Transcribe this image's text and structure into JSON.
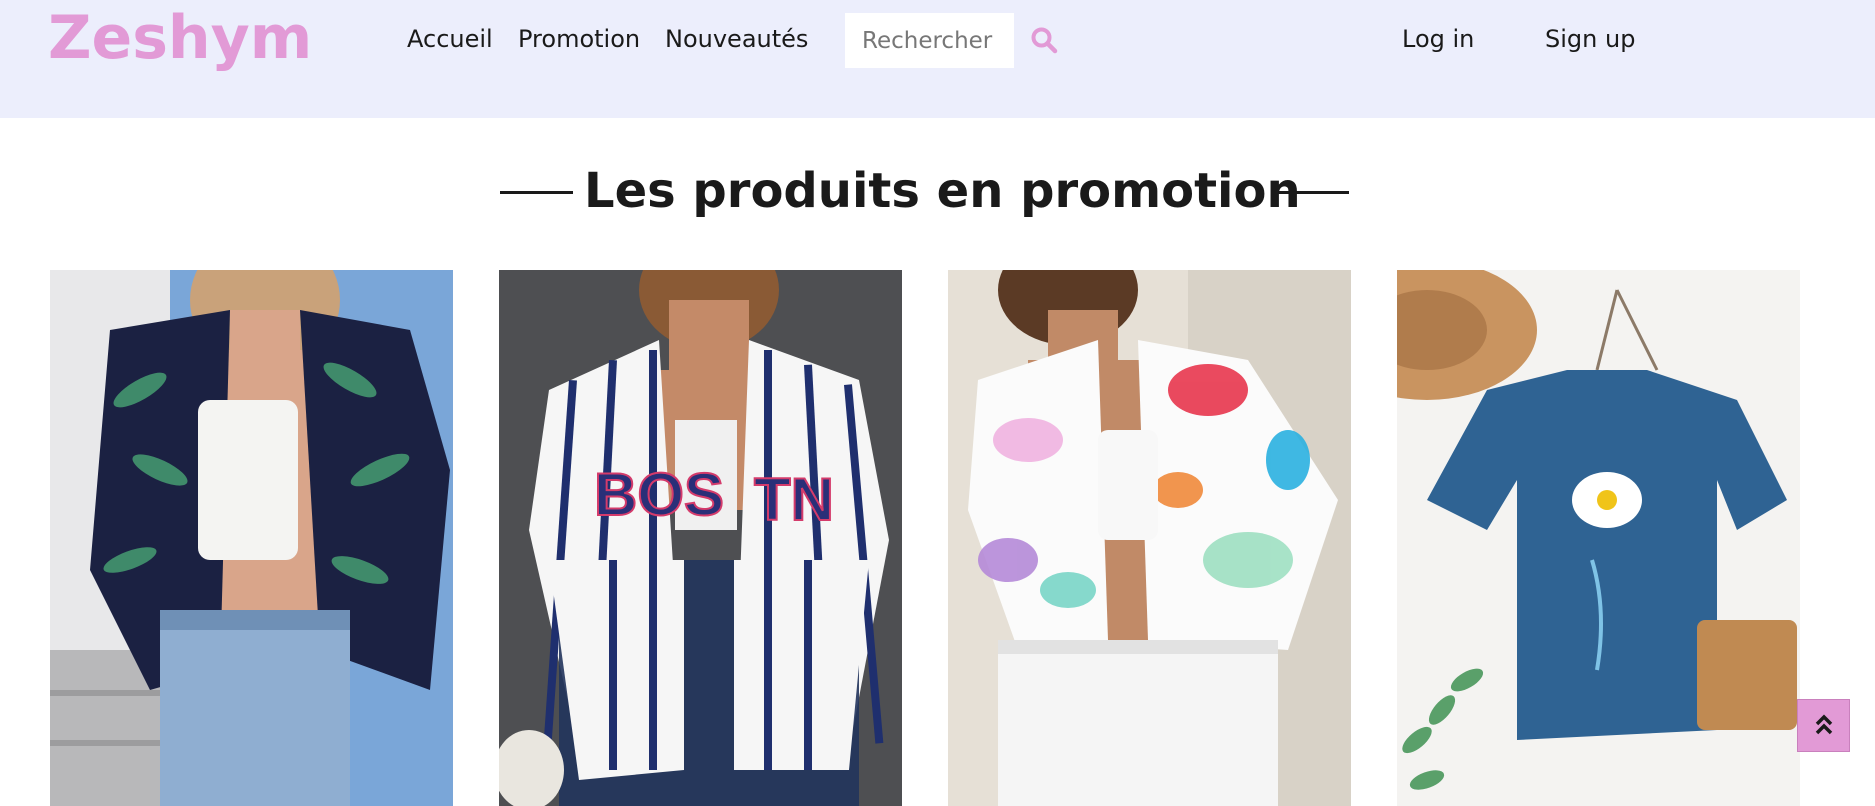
{
  "brand": {
    "logo": "Zeshym",
    "accent_color": "#e29ad6",
    "header_bg": "#eceefc"
  },
  "nav": {
    "links": [
      "Accueil",
      "Promotion",
      "Nouveautés"
    ],
    "search_placeholder": "Rechercher",
    "search_icon": "search-icon",
    "login": "Log in",
    "signup": "Sign up"
  },
  "section": {
    "title": "Les produits en promotion"
  },
  "products": [
    {
      "image": "palm print button-up shirt with white crop top and denim shorts"
    },
    {
      "image": "white striped baseball jersey shirt"
    },
    {
      "image": "abstract face print cropped shirt"
    },
    {
      "image": "blue daisy print t-shirt on hanger"
    }
  ],
  "scroll_top_icon": "double-chevron-up-icon"
}
